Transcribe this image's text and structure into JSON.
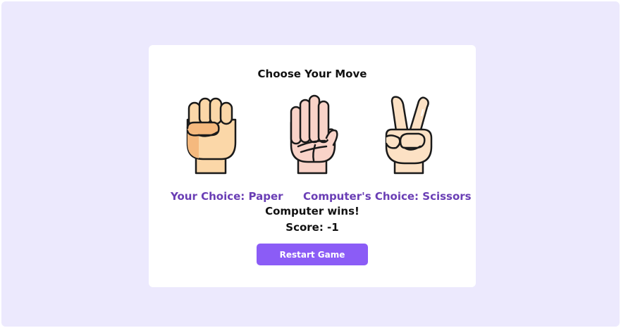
{
  "title": "Choose Your Move",
  "moves": [
    {
      "name": "rock",
      "icon": "fist-icon"
    },
    {
      "name": "paper",
      "icon": "open-palm-icon"
    },
    {
      "name": "scissors",
      "icon": "peace-sign-icon"
    }
  ],
  "your_choice": "Your Choice: Paper",
  "computer_choice": "Computer's Choice: Scissors",
  "result": "Computer wins!",
  "score": "Score: -1",
  "restart_label": "Restart Game",
  "colors": {
    "background": "#ece9fd",
    "card": "#ffffff",
    "choice_text": "#6a3eb5",
    "button": "#8b5cf6",
    "skin_light": "#fbd7a8",
    "skin_shadow": "#f5b97e",
    "palm_pink": "#f9d3c8"
  }
}
